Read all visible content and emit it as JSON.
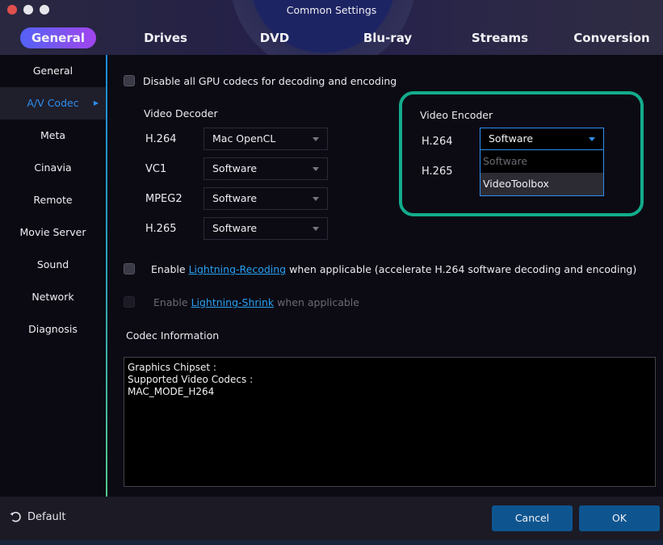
{
  "window": {
    "title": "Common Settings",
    "traffic_lights": [
      "close",
      "minimize",
      "maximize"
    ]
  },
  "tabs": [
    {
      "label": "General",
      "active": true
    },
    {
      "label": "Drives",
      "active": false
    },
    {
      "label": "DVD",
      "active": false
    },
    {
      "label": "Blu-ray",
      "active": false
    },
    {
      "label": "Streams",
      "active": false
    },
    {
      "label": "Conversion",
      "active": false
    }
  ],
  "sidebar": {
    "items": [
      {
        "label": "General",
        "active": false
      },
      {
        "label": "A/V Codec",
        "active": true
      },
      {
        "label": "Meta",
        "active": false
      },
      {
        "label": "Cinavia",
        "active": false
      },
      {
        "label": "Remote",
        "active": false
      },
      {
        "label": "Movie Server",
        "active": false
      },
      {
        "label": "Sound",
        "active": false
      },
      {
        "label": "Network",
        "active": false
      },
      {
        "label": "Diagnosis",
        "active": false
      }
    ],
    "active_caret": "▶"
  },
  "main": {
    "disable_gpu": {
      "label": "Disable all GPU codecs for decoding and encoding",
      "checked": false
    },
    "video_decoder": {
      "title": "Video Decoder",
      "rows": [
        {
          "codec": "H.264",
          "value": "Mac OpenCL"
        },
        {
          "codec": "VC1",
          "value": "Software"
        },
        {
          "codec": "MPEG2",
          "value": "Software"
        },
        {
          "codec": "H.265",
          "value": "Software"
        }
      ]
    },
    "video_encoder": {
      "title": "Video Encoder",
      "rows": [
        {
          "codec": "H.264",
          "value": "Software",
          "open": true
        },
        {
          "codec": "H.265",
          "value": ""
        }
      ],
      "dropdown_options": [
        {
          "label": "Software",
          "state": "selected-dim"
        },
        {
          "label": "VideoToolbox",
          "state": "hover"
        }
      ],
      "highlight_color": "#12ac8c"
    },
    "lightning_recoding": {
      "prefix": "Enable ",
      "link": "Lightning-Recoding",
      "suffix": " when applicable (accelerate H.264 software decoding and encoding)",
      "checked": false
    },
    "lightning_shrink": {
      "prefix": "Enable ",
      "link": "Lightning-Shrink",
      "suffix": " when applicable",
      "checked": false,
      "disabled": true
    },
    "codec_info": {
      "title": "Codec Information",
      "lines": [
        "Graphics Chipset :",
        "Supported Video Codecs :",
        "MAC_MODE_H264"
      ]
    }
  },
  "footer": {
    "default_label": "Default",
    "cancel_label": "Cancel",
    "ok_label": "OK"
  },
  "colors": {
    "accent_blue": "#2f8ff0",
    "button_blue": "#0e5590",
    "link_blue": "#27a0f0"
  }
}
